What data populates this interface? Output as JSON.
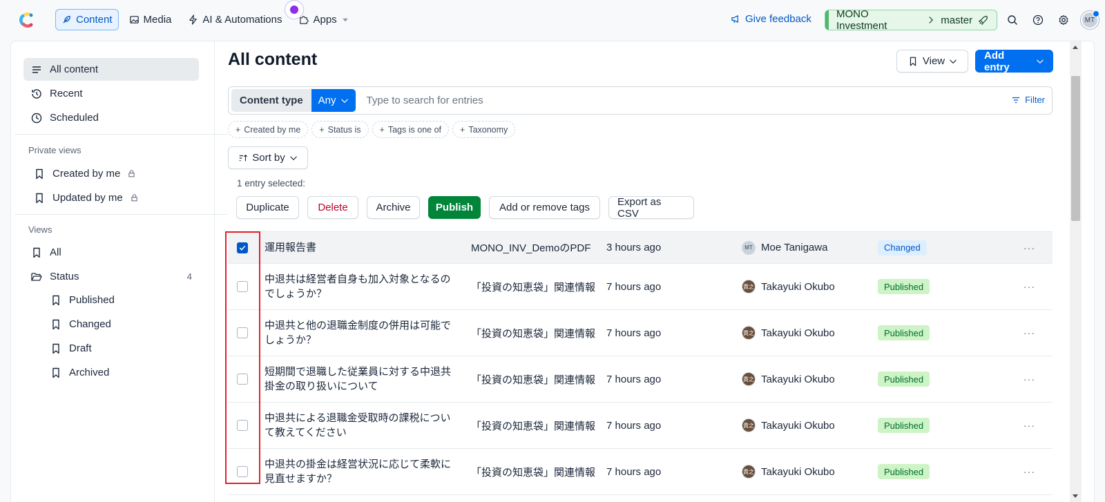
{
  "topnav": {
    "items": [
      {
        "label": "Content",
        "icon": "feather-icon",
        "active": true
      },
      {
        "label": "Media",
        "icon": "image-icon"
      },
      {
        "label": "AI & Automations",
        "icon": "bolt-icon"
      },
      {
        "label": "Apps",
        "icon": "puzzle-icon"
      }
    ],
    "feedback": "Give feedback",
    "space": "MONO Investment",
    "environment": "master",
    "avatar_initials": "MT"
  },
  "sidebar": {
    "items": [
      {
        "label": "All content",
        "icon": "list-icon"
      },
      {
        "label": "Recent",
        "icon": "history-icon"
      },
      {
        "label": "Scheduled",
        "icon": "clock-icon"
      }
    ],
    "private_views_title": "Private views",
    "private_views": [
      {
        "label": "Created by me"
      },
      {
        "label": "Updated by me"
      }
    ],
    "views_title": "Views",
    "views_all": "All",
    "status_folder": {
      "label": "Status",
      "count": "4"
    },
    "status_items": [
      {
        "label": "Published"
      },
      {
        "label": "Changed"
      },
      {
        "label": "Draft"
      },
      {
        "label": "Archived"
      }
    ]
  },
  "main": {
    "title": "All content",
    "view_label": "View",
    "add_entry_label": "Add entry",
    "search": {
      "content_type_label": "Content type",
      "any_label": "Any",
      "placeholder": "Type to search for entries",
      "filter_label": "Filter"
    },
    "filter_pills": [
      "Created by me",
      "Status is",
      "Tags is one of",
      "Taxonomy"
    ],
    "sort_label": "Sort by",
    "selection_text": "1 entry selected:",
    "bulk_actions": {
      "duplicate": "Duplicate",
      "delete": "Delete",
      "archive": "Archive",
      "publish": "Publish",
      "tags": "Add or remove tags",
      "export": "Export as CSV"
    },
    "rows": [
      {
        "checked": true,
        "title": "運用報告書",
        "content_type": "MONO_INV_DemoのPDF",
        "updated": "3 hours ago",
        "author": "Moe Tanigawa",
        "author_initials": "MT",
        "status": "Changed"
      },
      {
        "checked": false,
        "title": "中退共は経営者自身も加入対象となるのでしょうか？",
        "content_type": "「投資の知恵袋」関連情報",
        "updated": "7 hours ago",
        "author": "Takayuki Okubo",
        "author_initials": "貴之",
        "status": "Published"
      },
      {
        "checked": false,
        "title": "中退共と他の退職金制度の併用は可能でしょうか？",
        "content_type": "「投資の知恵袋」関連情報",
        "updated": "7 hours ago",
        "author": "Takayuki Okubo",
        "author_initials": "貴之",
        "status": "Published"
      },
      {
        "checked": false,
        "title": "短期間で退職した従業員に対する中退共掛金の取り扱いについて",
        "content_type": "「投資の知恵袋」関連情報",
        "updated": "7 hours ago",
        "author": "Takayuki Okubo",
        "author_initials": "貴之",
        "status": "Published"
      },
      {
        "checked": false,
        "title": "中退共による退職金受取時の課税について教えてください",
        "content_type": "「投資の知恵袋」関連情報",
        "updated": "7 hours ago",
        "author": "Takayuki Okubo",
        "author_initials": "貴之",
        "status": "Published"
      },
      {
        "checked": false,
        "title": "中退共の掛金は経営状況に応じて柔軟に見直せますか？",
        "content_type": "「投資の知恵袋」関連情報",
        "updated": "7 hours ago",
        "author": "Takayuki Okubo",
        "author_initials": "貴之",
        "status": "Published"
      }
    ]
  },
  "colors": {
    "accent": "#0070f0",
    "publish": "#008539",
    "highlight": "#e0202a"
  }
}
